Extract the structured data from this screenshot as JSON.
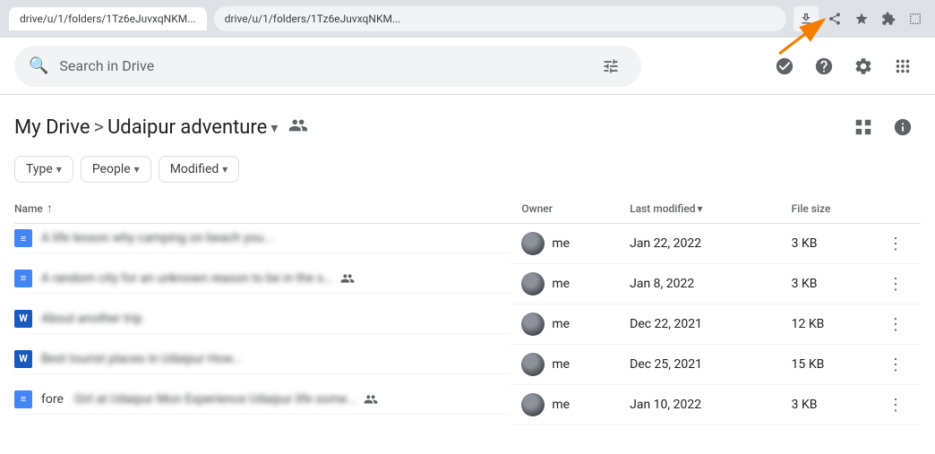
{
  "browser": {
    "tab_text": "drive/u/1/folders/1Tz6eJuvxqNKM...",
    "address_url": "drive/u/1/folders/1Tz6eJuvxqNKM..."
  },
  "header": {
    "search_placeholder": "Search in Drive",
    "settings_tooltip": "Settings",
    "help_tooltip": "Help",
    "apps_tooltip": "Google apps"
  },
  "breadcrumb": {
    "root": "My Drive",
    "separator": ">",
    "current": "Udaipur adventure",
    "chevron": "▾"
  },
  "filters": [
    {
      "label": "Type",
      "arrow": "▾"
    },
    {
      "label": "People",
      "arrow": "▾"
    },
    {
      "label": "Modified",
      "arrow": "▾"
    }
  ],
  "table": {
    "columns": {
      "name": "Name",
      "sort_icon": "↑",
      "owner": "Owner",
      "last_modified": "Last modified",
      "lm_sort": "▾",
      "file_size": "File size"
    },
    "rows": [
      {
        "icon_type": "docs",
        "name": "blurred-text-1",
        "shared": false,
        "owner": "me",
        "last_modified": "Jan 22, 2022",
        "file_size": "3 KB"
      },
      {
        "icon_type": "docs",
        "name": "blurred-text-2",
        "shared": true,
        "owner": "me",
        "last_modified": "Jan 8, 2022",
        "file_size": "3 KB"
      },
      {
        "icon_type": "word",
        "name": "blurred-text-3",
        "shared": false,
        "owner": "me",
        "last_modified": "Dec 22, 2021",
        "file_size": "12 KB"
      },
      {
        "icon_type": "word",
        "name": "blurred-text-4",
        "shared": false,
        "owner": "me",
        "last_modified": "Dec 25, 2021",
        "file_size": "15 KB"
      },
      {
        "icon_type": "docs",
        "name": "blurred-text-5",
        "shared": true,
        "extra_text": "fore",
        "owner": "me",
        "last_modified": "Jan 10, 2022",
        "file_size": "3 KB"
      }
    ]
  }
}
